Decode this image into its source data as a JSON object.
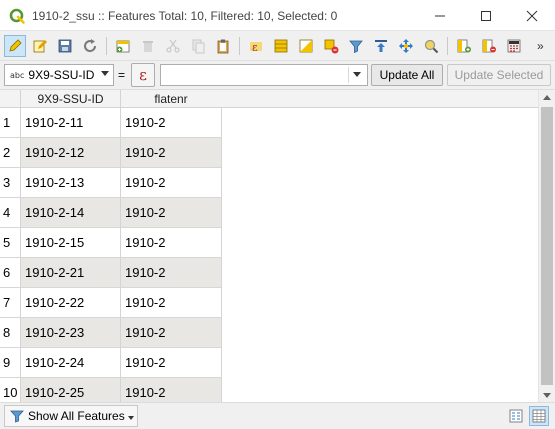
{
  "window": {
    "title": "1910-2_ssu :: Features Total: 10, Filtered: 10, Selected: 0",
    "minimize_glyph": "—",
    "maximize_glyph": "☐",
    "close_glyph": "✕"
  },
  "toolbar": {
    "more_glyph": "»",
    "buttons": [
      {
        "name": "toggle-editing-icon",
        "active": true
      },
      {
        "name": "toggle-multi-edit-icon"
      },
      {
        "name": "save-edits-icon"
      },
      {
        "name": "reload-table-icon"
      },
      {
        "name": "add-feature-icon"
      },
      {
        "name": "delete-selected-icon",
        "disabled": true
      },
      {
        "name": "cut-icon",
        "disabled": true
      },
      {
        "name": "copy-icon",
        "disabled": true
      },
      {
        "name": "paste-icon"
      },
      {
        "name": "expression-select-icon"
      },
      {
        "name": "select-all-icon"
      },
      {
        "name": "invert-selection-icon"
      },
      {
        "name": "deselect-all-icon"
      },
      {
        "name": "filter-select-icon"
      },
      {
        "name": "move-selection-top-icon"
      },
      {
        "name": "pan-to-selected-icon"
      },
      {
        "name": "zoom-to-selected-icon"
      },
      {
        "name": "new-field-icon"
      },
      {
        "name": "delete-field-icon"
      },
      {
        "name": "field-calculator-icon"
      }
    ]
  },
  "filter": {
    "field_type_badge": "abc",
    "field_name": "9X9-SSU-ID",
    "operator": "=",
    "expression_glyph": "ε",
    "value": "",
    "update_all_label": "Update All",
    "update_selected_label": "Update Selected"
  },
  "table": {
    "columns": [
      "9X9-SSU-ID",
      "flatenr"
    ],
    "rows": [
      {
        "num": "1",
        "id": "1910-2-11",
        "flatenr": "1910-2"
      },
      {
        "num": "2",
        "id": "1910-2-12",
        "flatenr": "1910-2"
      },
      {
        "num": "3",
        "id": "1910-2-13",
        "flatenr": "1910-2"
      },
      {
        "num": "4",
        "id": "1910-2-14",
        "flatenr": "1910-2"
      },
      {
        "num": "5",
        "id": "1910-2-15",
        "flatenr": "1910-2"
      },
      {
        "num": "6",
        "id": "1910-2-21",
        "flatenr": "1910-2"
      },
      {
        "num": "7",
        "id": "1910-2-22",
        "flatenr": "1910-2"
      },
      {
        "num": "8",
        "id": "1910-2-23",
        "flatenr": "1910-2"
      },
      {
        "num": "9",
        "id": "1910-2-24",
        "flatenr": "1910-2"
      },
      {
        "num": "10",
        "id": "1910-2-25",
        "flatenr": "1910-2"
      }
    ]
  },
  "footer": {
    "show_features_label": "Show All Features"
  },
  "colors": {
    "accent": "#f3c300",
    "qgis_green": "#589632",
    "alt_row": "#e9e7e3"
  }
}
